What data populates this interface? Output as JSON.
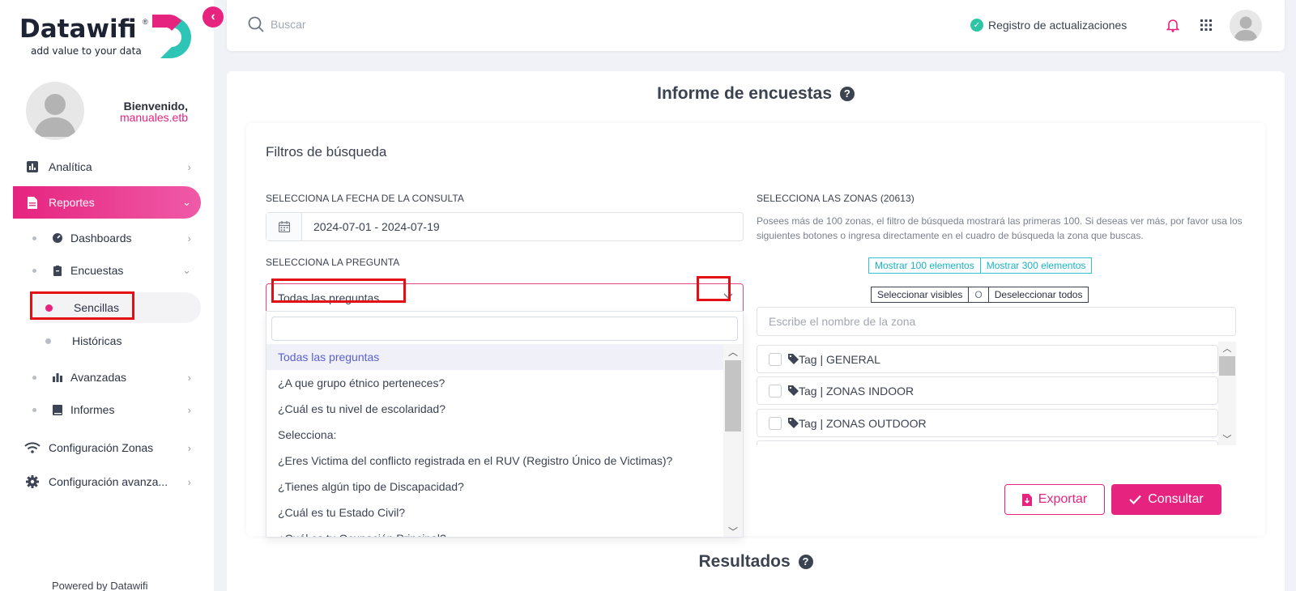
{
  "brand": {
    "name": "Datawifi",
    "tagline": "add value to your data",
    "registered": "®",
    "colors": {
      "primary": "#e6247f",
      "teal": "#2ec4b6"
    }
  },
  "sidebar": {
    "welcome": "Bienvenido,",
    "username": "manuales.etb",
    "items": [
      {
        "label": "Analítica",
        "icon": "chart-bar-icon"
      },
      {
        "label": "Reportes",
        "icon": "document-icon",
        "active": true
      },
      {
        "label": "Configuración Zonas",
        "icon": "wifi-icon"
      },
      {
        "label": "Configuración avanza...",
        "icon": "gear-icon"
      }
    ],
    "reportes_sub": [
      {
        "label": "Dashboards",
        "icon": "gauge-icon"
      },
      {
        "label": "Encuestas",
        "icon": "clipboard-icon"
      },
      {
        "label": "Avanzadas",
        "icon": "bars-icon"
      },
      {
        "label": "Informes",
        "icon": "book-icon"
      }
    ],
    "encuestas_sub": [
      {
        "label": "Sencillas",
        "selected": true
      },
      {
        "label": "Históricas"
      }
    ],
    "powered": "Powered by Datawifi"
  },
  "topbar": {
    "search_placeholder": "Buscar",
    "updates_label": "Registro de actualizaciones"
  },
  "main": {
    "title": "Informe de encuestas",
    "filters_title": "Filtros de búsqueda",
    "date_label": "SELECCIONA LA FECHA DE LA CONSULTA",
    "date_value": "2024-07-01 - 2024-07-19",
    "question_label": "SELECCIONA LA PREGUNTA",
    "question_value": "Todas las preguntas",
    "question_options": [
      "Todas las preguntas",
      "¿A que grupo étnico perteneces?",
      "¿Cuál es tu nivel de escolaridad?",
      "Selecciona:",
      "¿Eres Victima del conflicto registrada en el RUV (Registro Único de Victimas)?",
      "¿Tienes algún tipo de Discapacidad?",
      "¿Cuál es tu Estado Civil?",
      "¿Cuál es tu Ocupación Principal?"
    ],
    "zones_label": "SELECCIONA LAS ZONAS (20613)",
    "zones_desc": "Posees más de 100 zonas, el filtro de búsqueda mostrará las primeras 100. Si deseas ver más, por favor usa los siguientes botones o ingresa directamente en el cuadro de búsqueda la zona que buscas.",
    "show_100": "Mostrar 100 elementos",
    "show_300": "Mostrar 300 elementos",
    "select_visible": "Seleccionar visibles",
    "separator": "O",
    "deselect_all": "Deseleccionar todos",
    "zone_search_placeholder": "Escribe el nombre de la zona",
    "zones": [
      "Tag | GENERAL",
      "Tag | ZONAS INDOOR",
      "Tag | ZONAS OUTDOOR"
    ],
    "export_label": "Exportar",
    "consult_label": "Consultar",
    "results_title": "Resultados"
  }
}
